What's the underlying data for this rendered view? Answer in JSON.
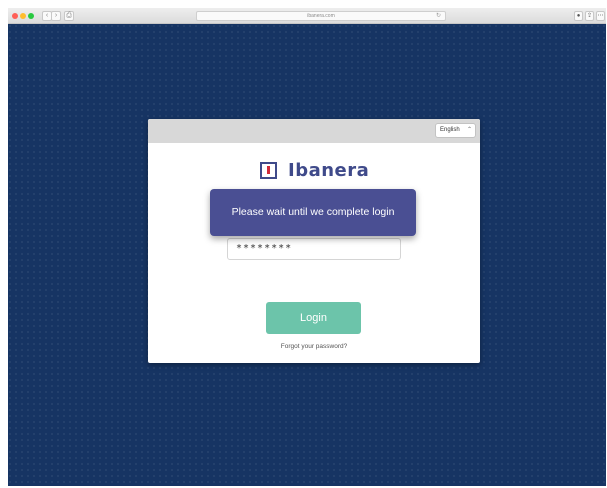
{
  "browser": {
    "url": "ibanera.com",
    "back_glyph": "‹",
    "forward_glyph": "›",
    "share_glyph": "⎙",
    "reload_glyph": "↻",
    "tool_glyphs": [
      "●",
      "⇪",
      "⋯"
    ]
  },
  "login_card": {
    "language": "English",
    "language_chevron": "⌃",
    "brand_name": "Ibanera",
    "password_value": "********",
    "login_label": "Login",
    "forgot_label": "Forgot your password?"
  },
  "toast": {
    "message": "Please wait until we complete login"
  },
  "colors": {
    "background": "#163463",
    "brand": "#3f4a8a",
    "brand_accent": "#d22b3a",
    "login_button": "#6cc4aa",
    "toast": "#4a4f93"
  }
}
